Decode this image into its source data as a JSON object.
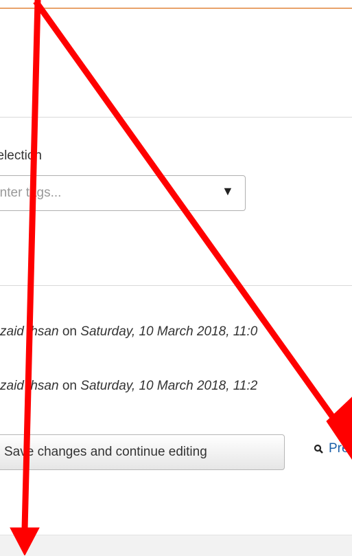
{
  "tags": {
    "label": "selection",
    "placeholder": "Enter tags...",
    "dropdown_icon": "triangle-down-icon"
  },
  "history": [
    {
      "user": "zaid ihsan",
      "connector": "on",
      "date": "Saturday, 10 March 2018, 11:0"
    },
    {
      "user": "zaid ihsan",
      "connector": "on",
      "date": "Saturday, 10 March 2018, 11:2"
    }
  ],
  "actions": {
    "save_continue_label": "Save changes and continue editing",
    "preview_label": "Pre",
    "preview_icon": "search-icon"
  },
  "annotations": {
    "arrow_color": "#ff0000"
  },
  "colors": {
    "accent_border": "#e8a36a",
    "link": "#1a5fa8"
  }
}
